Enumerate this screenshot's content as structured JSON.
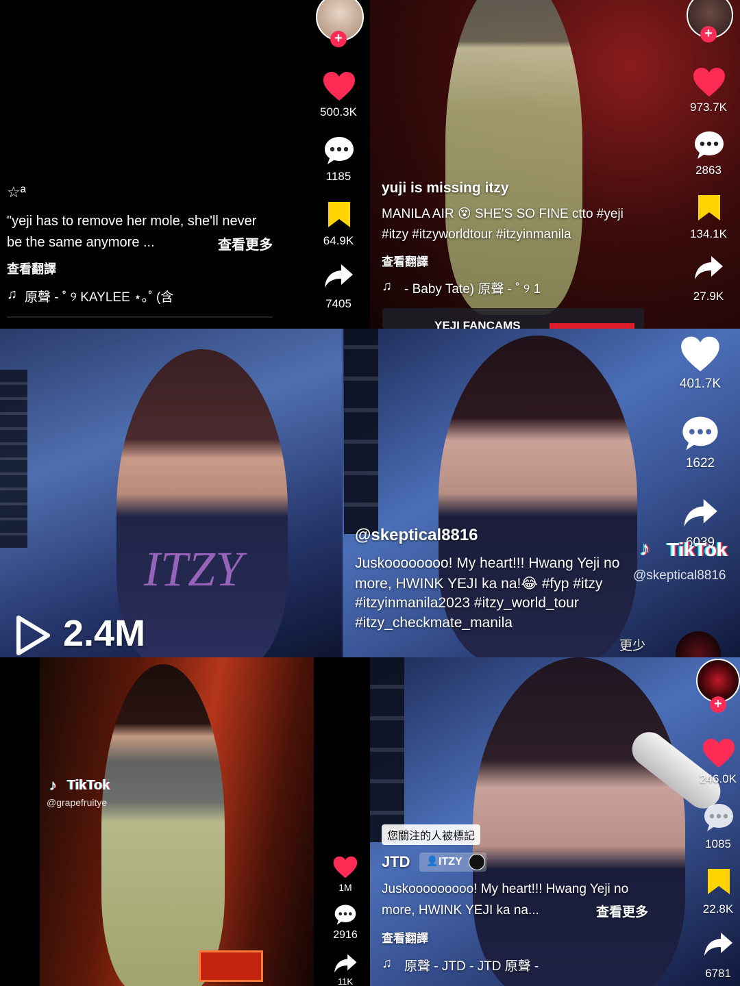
{
  "p1": {
    "likes": "500.3K",
    "comments": "1185",
    "saves": "64.9K",
    "shares": "7405",
    "username": "☆ª",
    "caption_line1": "\"yeji has to remove her mole, she'll never",
    "caption_line2": "be the same anymore ...",
    "see_more": "查看更多",
    "translate": "查看翻譯",
    "music_icon": "♫",
    "music": "原聲 - ˚ ୨ KAYLEE ⋆｡˚ (含"
  },
  "p2": {
    "likes": "973.7K",
    "comments": "2863",
    "saves": "134.1K",
    "shares": "27.9K",
    "username": "yuji is missing itzy",
    "caption_line1": "MANILA AIR 😵 SHE'S SO FINE ctto #yeji",
    "caption_line2": "#itzy #itzyworldtour #itzyinmanila",
    "translate": "查看翻譯",
    "music_icon": "♫",
    "music": "- Baby Tate)   原聲 - ˚ ୨ 1",
    "banner": "YEJI FANCAMS"
  },
  "p3": {
    "play_icon": "play-outline-icon",
    "views": "2.4M",
    "shirt_text": "ITZY"
  },
  "p4": {
    "likes": "401.7K",
    "comments": "1622",
    "shares": "6039",
    "username": "@skeptical8816",
    "caption_line1": "Juskoooooooo! My heart!!! Hwang Yeji no",
    "caption_line2": "more, HWINK YEJI ka na!😂 #fyp #itzy",
    "caption_line3": "#itzyinmanila2023 #itzy_world_tour",
    "caption_line4": "#itzy_checkmate_manila",
    "less": "更少",
    "watermark": "TikTok",
    "watermark_handle": "@skeptical8816"
  },
  "p5": {
    "watermark": "TikTok",
    "watermark_handle": "@grapefruitye",
    "likes": "1M",
    "comments": "2916",
    "shares": "11K"
  },
  "p6": {
    "tag": "您關注的人被標記",
    "username": "JTD",
    "badge": "ITZY",
    "caption_line1": "Juskooooooooo! My heart!!! Hwang Yeji no",
    "caption_line2": "more, HWINK YEJI ka na...",
    "see_more": "查看更多",
    "translate": "查看翻譯",
    "music_icon": "♫",
    "music": "原聲 - JTD - JTD    原聲 -",
    "likes": "246.0K",
    "comments": "1085",
    "saves": "22.8K",
    "shares": "6781"
  },
  "colors": {
    "like_red": "#fe2c55",
    "save_yellow": "#ffd400",
    "accent_pink": "#fe2c55"
  }
}
